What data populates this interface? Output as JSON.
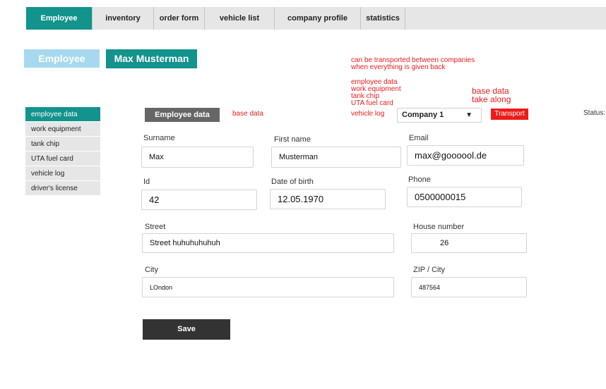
{
  "nav": {
    "tabs": [
      {
        "label": "Employee"
      },
      {
        "label": "inventory"
      },
      {
        "label": "order form"
      },
      {
        "label": "vehicle list"
      },
      {
        "label": "company profile"
      },
      {
        "label": "statistics"
      }
    ]
  },
  "header": {
    "section": "Employee",
    "employee_name": "Max Musterman"
  },
  "notes": {
    "transport_line1": "can be transported between companies",
    "transport_line2": "when everything is given back",
    "list": [
      "employee data",
      "work equipment",
      "tank chip",
      "UTA fuel card",
      "vehicle log"
    ],
    "base_data_take_along_1": "base data",
    "base_data_take_along_2": "take along",
    "base_data": "base data",
    "status": "Status:"
  },
  "sidebar": {
    "items": [
      {
        "label": "employee data"
      },
      {
        "label": "work equipment"
      },
      {
        "label": "tank chip"
      },
      {
        "label": "UTA fuel card"
      },
      {
        "label": "vehicle log"
      },
      {
        "label": "driver's license"
      }
    ]
  },
  "section_tab": "Employee data",
  "company": {
    "selected": "Company 1",
    "caret": "▼"
  },
  "transport_button": "Transport",
  "form": {
    "surname": {
      "label": "Surname",
      "value": "Max"
    },
    "first_name": {
      "label": "First name",
      "value": "Musterman"
    },
    "email": {
      "label": "Email",
      "value": "max@goooool.de"
    },
    "id": {
      "label": "Id",
      "value": "42"
    },
    "dob": {
      "label": "Date of birth",
      "value": "12.05.1970"
    },
    "phone": {
      "label": "Phone",
      "value": "0500000015"
    },
    "street": {
      "label": "Street",
      "value": "Street huhuhuhuhuh"
    },
    "house_number": {
      "label": "House number",
      "value": "26"
    },
    "city": {
      "label": "City",
      "value": "LOndon"
    },
    "zip_city": {
      "label": "ZIP / City",
      "value": "487564"
    }
  },
  "save_label": "Save",
  "colors": {
    "accent": "#12938c",
    "accent_light": "#a6d9ef",
    "note_red": "#ee1b1b",
    "dark_button": "#333333"
  }
}
